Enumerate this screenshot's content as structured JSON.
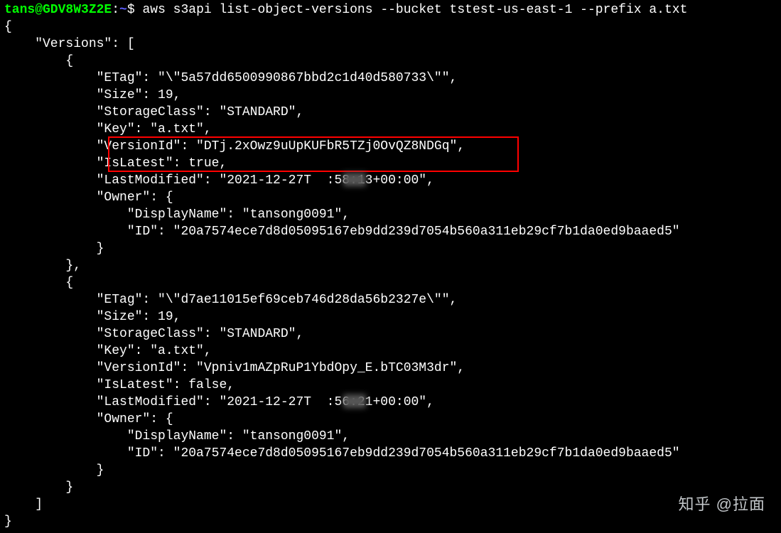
{
  "prompt": {
    "user_host": "tans@GDV8W3Z2E",
    "sep1": ":",
    "path": "~",
    "dollar": "$ "
  },
  "command": "aws s3api list-object-versions --bucket tstest-us-east-1 --prefix a.txt",
  "out": {
    "l0": "{",
    "l1": "    \"Versions\": [",
    "l2": "        {",
    "l3": "            \"ETag\": \"\\\"5a57dd6500990867bbd2c1d40d580733\\\"\",",
    "l4": "            \"Size\": 19,",
    "l5": "            \"StorageClass\": \"STANDARD\",",
    "l6": "            \"Key\": \"a.txt\",",
    "l7": "            \"VersionId\": \"DTj.2xOwz9uUpKUFbR5TZj0OvQZ8NDGq\",",
    "l8": "            \"IsLatest\": true,",
    "l9": "            \"LastModified\": \"2021-12-27T  :58:13+00:00\",",
    "l10": "            \"Owner\": {",
    "l11": "                \"DisplayName\": \"tansong0091\",",
    "l12": "                \"ID\": \"20a7574ece7d8d05095167eb9dd239d7054b560a311eb29cf7b1da0ed9baaed5\"",
    "l13": "            }",
    "l14": "        },",
    "l15": "        {",
    "l16": "            \"ETag\": \"\\\"d7ae11015ef69ceb746d28da56b2327e\\\"\",",
    "l17": "            \"Size\": 19,",
    "l18": "            \"StorageClass\": \"STANDARD\",",
    "l19": "            \"Key\": \"a.txt\",",
    "l20": "            \"VersionId\": \"Vpniv1mAZpRuP1YbdOpy_E.bTC03M3dr\",",
    "l21": "            \"IsLatest\": false,",
    "l22": "            \"LastModified\": \"2021-12-27T  :56:21+00:00\",",
    "l23": "            \"Owner\": {",
    "l24": "                \"DisplayName\": \"tansong0091\",",
    "l25": "                \"ID\": \"20a7574ece7d8d05095167eb9dd239d7054b560a311eb29cf7b1da0ed9baaed5\"",
    "l26": "            }",
    "l27": "        }",
    "l28": "    ]",
    "l29": "}"
  },
  "watermark": "知乎 @拉面"
}
